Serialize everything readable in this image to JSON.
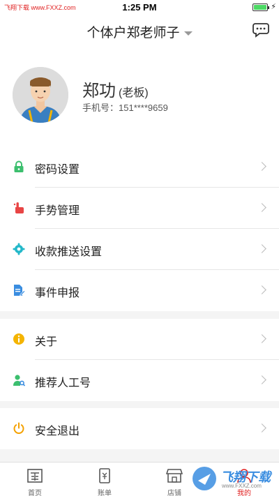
{
  "status_bar": {
    "source": "飞翔下载 www.FXXZ.com",
    "time": "1:25 PM",
    "battery_level": 1.0
  },
  "nav": {
    "title": "个体户郑老师子",
    "chat_icon": "chat-bubble-icon"
  },
  "profile": {
    "name": "郑功",
    "role": "(老板)",
    "phone": "手机号：151****9659"
  },
  "menu_section_1": [
    {
      "label": "密码设置",
      "icon": "lock-icon",
      "color": "#3cbf6e"
    },
    {
      "label": "手势管理",
      "icon": "hand-pointer-icon",
      "color": "#e84545"
    },
    {
      "label": "收款推送设置",
      "icon": "gear-icon",
      "color": "#23b8c9"
    },
    {
      "label": "事件申报",
      "icon": "document-edit-icon",
      "color": "#3a8de0"
    }
  ],
  "menu_section_2": [
    {
      "label": "关于",
      "icon": "info-icon",
      "color": "#f4b400"
    },
    {
      "label": "推荐人工号",
      "icon": "user-search-icon",
      "color": "#3cbf6e"
    }
  ],
  "menu_section_3": [
    {
      "label": "安全退出",
      "icon": "power-icon",
      "color": "#f4a100"
    }
  ],
  "tab_bar": [
    {
      "label": "首页",
      "icon": "home-icon"
    },
    {
      "label": "账单",
      "icon": "bill-icon"
    },
    {
      "label": "店铺",
      "icon": "store-icon"
    },
    {
      "label": "我的",
      "icon": "user-icon",
      "active": true
    }
  ],
  "watermark": {
    "text": "飞翔下载",
    "sub": "www.FXXZ.com"
  }
}
